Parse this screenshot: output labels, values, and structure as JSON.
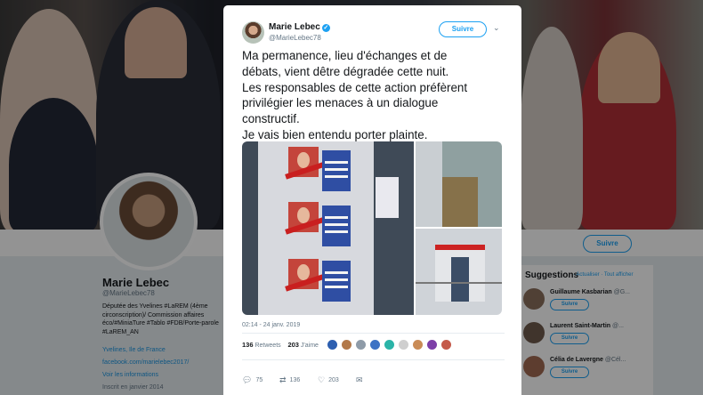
{
  "profile": {
    "name": "Marie Lebec",
    "handle": "@MarieLebec78",
    "bio": "Députée des Yvelines #LaREM (4ème circonscription)/ Commission affaires éco/#MiniaTure #Tablo #FDB/Porte-parole #LaREM_AN",
    "location": "Yvelines, Ile de France",
    "link": "facebook.com/marielebec2017/",
    "birth": "Voir les informations",
    "joined": "Inscrit en janvier 2014",
    "follow_label": "Suivre"
  },
  "suggestions": {
    "title": "Suggestions",
    "links": "· Actualiser · Tout afficher",
    "follow_label": "Suivre",
    "items": [
      {
        "name": "Guillaume Kasbarian",
        "handle": "@G..."
      },
      {
        "name": "Laurent Saint-Martin",
        "handle": "@..."
      },
      {
        "name": "Célia de Lavergne",
        "handle": "@Cél..."
      }
    ]
  },
  "tweet": {
    "author": "Marie Lebec",
    "handle": "@MarieLebec78",
    "follow_label": "Suivre",
    "lines": [
      "Ma permanence, lieu d'échanges et de",
      "débats, vient dêtre dégradée cette nuit.",
      "Les responsables de cette action préfèrent",
      "privilégier les menaces à un dialogue",
      "constructif.",
      "Je vais bien entendu porter plainte."
    ],
    "timestamp": "02:14 - 24 janv. 2019",
    "retweets_count": "136",
    "retweets_label": "Retweets",
    "likes_count": "203",
    "likes_label": "J'aime",
    "actions": {
      "reply": "75",
      "retweet": "136",
      "like": "203"
    }
  },
  "icons": {
    "verified": "verified-badge-icon",
    "chevron": "chevron-down-icon",
    "reply": "reply-icon",
    "retweet": "retweet-icon",
    "like": "heart-icon",
    "dm": "envelope-icon"
  },
  "colors": {
    "accent": "#1da1f2",
    "text": "#14171a",
    "muted": "#657786"
  }
}
